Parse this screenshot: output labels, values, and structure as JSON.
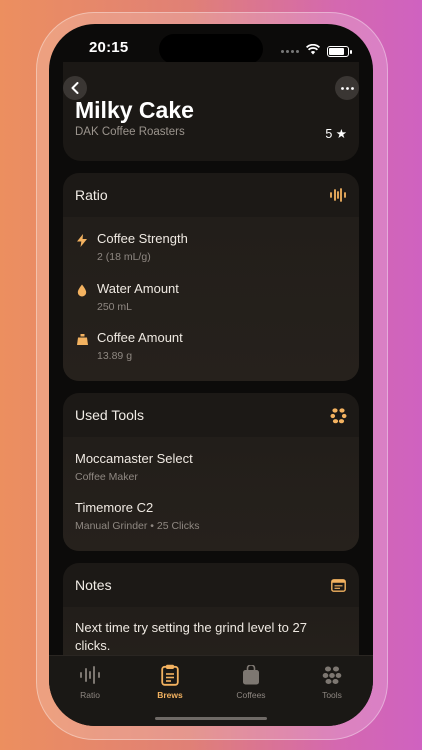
{
  "status_bar": {
    "time": "20:15"
  },
  "header": {
    "title": "Milky Cake",
    "roaster": "DAK Coffee Roasters",
    "rating": "5 ★"
  },
  "ratio": {
    "title": "Ratio",
    "items": [
      {
        "icon": "bolt-icon",
        "title": "Coffee Strength",
        "sub": "2 (18 mL/g)"
      },
      {
        "icon": "drop-icon",
        "title": "Water Amount",
        "sub": "250 mL"
      },
      {
        "icon": "scoop-icon",
        "title": "Coffee Amount",
        "sub": "13.89 g"
      }
    ]
  },
  "tools": {
    "title": "Used Tools",
    "items": [
      {
        "title": "Moccamaster Select",
        "sub": "Coffee Maker"
      },
      {
        "title": "Timemore C2",
        "sub": "Manual Grinder • 25 Clicks"
      }
    ]
  },
  "notes": {
    "title": "Notes",
    "text": "Next time try setting the grind level to 27 clicks."
  },
  "tabbar": {
    "tabs": [
      {
        "label": "Ratio",
        "icon": "waveform-icon",
        "active": false
      },
      {
        "label": "Brews",
        "icon": "clipboard-icon",
        "active": true
      },
      {
        "label": "Coffees",
        "icon": "bag-icon",
        "active": false
      },
      {
        "label": "Tools",
        "icon": "beans-icon",
        "active": false
      }
    ]
  },
  "colors": {
    "accent": "#f3b260",
    "background": "#0c0b0a",
    "card": "#1c1916"
  }
}
